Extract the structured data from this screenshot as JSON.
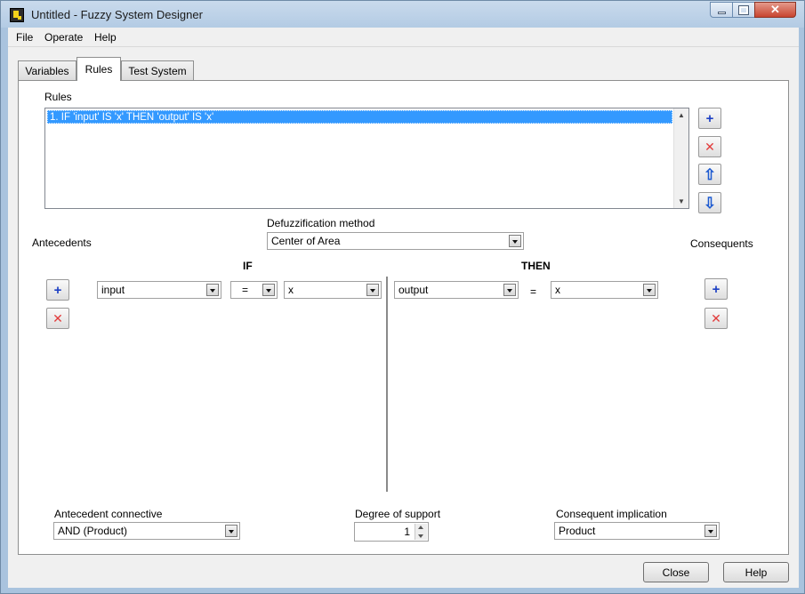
{
  "window": {
    "title": "Untitled - Fuzzy System Designer"
  },
  "menu": [
    "File",
    "Operate",
    "Help"
  ],
  "tabs": [
    "Variables",
    "Rules",
    "Test System"
  ],
  "rules": {
    "label": "Rules",
    "items": [
      "1. IF 'input' IS 'x' THEN 'output' IS 'x'"
    ],
    "selected_index": 0
  },
  "defuzz": {
    "label": "Defuzzification method",
    "value": "Center of Area"
  },
  "antecedents": {
    "label": "Antecedents",
    "if_label": "IF",
    "variable": "input",
    "operator": "=",
    "term": "x"
  },
  "consequents": {
    "label": "Consequents",
    "then_label": "THEN",
    "variable": "output",
    "equals": "=",
    "term": "x"
  },
  "antecedent_connective": {
    "label": "Antecedent connective",
    "value": "AND (Product)"
  },
  "degree_of_support": {
    "label": "Degree of support",
    "value": "1"
  },
  "consequent_implication": {
    "label": "Consequent implication",
    "value": "Product"
  },
  "buttons": {
    "close": "Close",
    "help": "Help"
  },
  "colors": {
    "selection": "#3399ff",
    "add_icon": "#1c3fc4",
    "remove_icon": "#e23b3b"
  }
}
